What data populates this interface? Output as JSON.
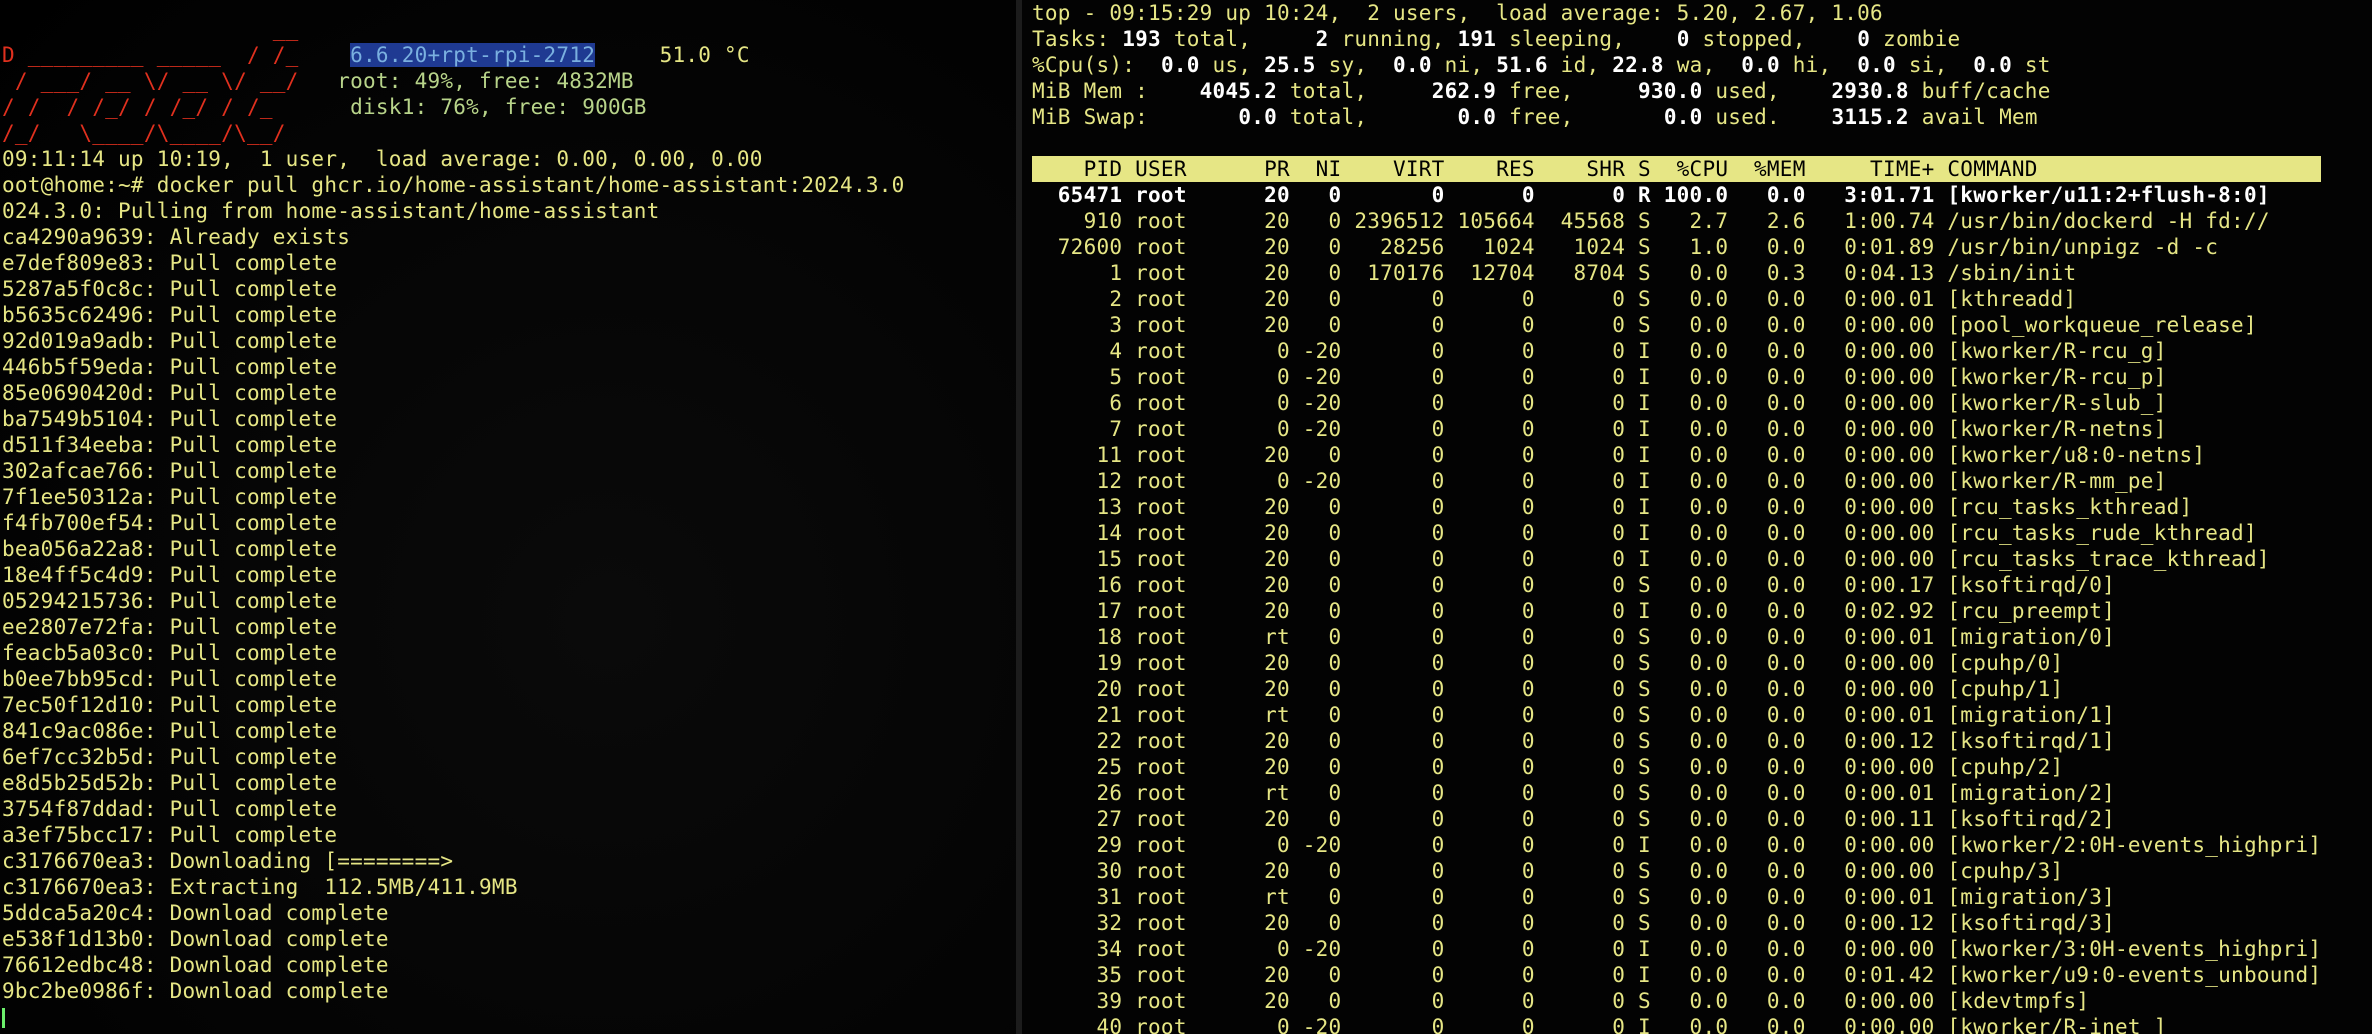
{
  "left_terminal": {
    "banner": {
      "logo_lines": [
        "                     __   ",
        "D _________ _____  / /_   ",
        " / ___/ __ \\/ __ \\/ __/ ",
        "/ /  / /_/ / /_/ / /_    ",
        "/_/   \\____/\\____/\\__/   "
      ],
      "kernel": "6.6.20+rpt-rpi-2712",
      "temperature": "51.0 °C",
      "root_usage": "root: 49%, free: 4832MB",
      "disk_usage": "disk1: 76%, free: 900GB"
    },
    "uptime_line": "09:11:14 up 10:19,  1 user,  load average: 0.00, 0.00, 0.00",
    "command_line": "oot@home:~# docker pull ghcr.io/home-assistant/home-assistant:2024.3.0",
    "output_lines": [
      "024.3.0: Pulling from home-assistant/home-assistant",
      "ca4290a9639: Already exists",
      "e7def809e83: Pull complete",
      "5287a5f0c8c: Pull complete",
      "b5635c62496: Pull complete",
      "92d019a9adb: Pull complete",
      "446b5f59eda: Pull complete",
      "85e0690420d: Pull complete",
      "ba7549b5104: Pull complete",
      "d511f34eeba: Pull complete",
      "302afcae766: Pull complete",
      "7f1ee50312a: Pull complete",
      "f4fb700ef54: Pull complete",
      "bea056a22a8: Pull complete",
      "18e4ff5c4d9: Pull complete",
      "05294215736: Pull complete",
      "ee2807e72fa: Pull complete",
      "feacb5a03c0: Pull complete",
      "b0ee7bb95cd: Pull complete",
      "7ec50f12d10: Pull complete",
      "841c9ac086e: Pull complete",
      "6ef7cc32b5d: Pull complete",
      "e8d5b25d52b: Pull complete",
      "3754f87ddad: Pull complete",
      "a3ef75bcc17: Pull complete",
      "c3176670ea3: Downloading [========>",
      "c3176670ea3: Extracting  112.5MB/411.9MB",
      "5ddca5a20c4: Download complete",
      "e538f1d13b0: Download complete",
      "76612edbc48: Download complete",
      "9bc2be0986f: Download complete"
    ]
  },
  "top": {
    "summary": {
      "line1": "top - 09:15:29 up 10:24,  2 users,  load average: 5.20, 2.67, 1.06",
      "tasks": {
        "label": "Tasks:",
        "total": "193",
        "running": "2",
        "sleeping": "191",
        "stopped": "0",
        "zombie": "0"
      },
      "cpu": {
        "label": "%Cpu(s):",
        "us": "0.0",
        "sy": "25.5",
        "ni": "0.0",
        "id": "51.6",
        "wa": "22.8",
        "hi": "0.0",
        "si": "0.0",
        "st": "0.0"
      },
      "mem": {
        "label": "MiB Mem :",
        "total": "4045.2",
        "free": "262.9",
        "used": "930.0",
        "buff_cache": "2930.8"
      },
      "swap": {
        "label": "MiB Swap:",
        "total": "0.0",
        "free": "0.0",
        "used": "0.0",
        "avail_mem": "3115.2"
      }
    },
    "header": "    PID USER      PR  NI    VIRT    RES    SHR S  %CPU  %MEM     TIME+ COMMAND",
    "rows": [
      "  65471 root      20   0       0      0      0 R 100.0   0.0   3:01.71 [kworker/u11:2+flush-8:0]",
      "    910 root      20   0 2396512 105664  45568 S   2.7   2.6   1:00.74 /usr/bin/dockerd -H fd://",
      "  72600 root      20   0   28256   1024   1024 S   1.0   0.0   0:01.89 /usr/bin/unpigz -d -c",
      "      1 root      20   0  170176  12704   8704 S   0.0   0.3   0:04.13 /sbin/init",
      "      2 root      20   0       0      0      0 S   0.0   0.0   0:00.01 [kthreadd]",
      "      3 root      20   0       0      0      0 S   0.0   0.0   0:00.00 [pool_workqueue_release]",
      "      4 root       0 -20       0      0      0 I   0.0   0.0   0:00.00 [kworker/R-rcu_g]",
      "      5 root       0 -20       0      0      0 I   0.0   0.0   0:00.00 [kworker/R-rcu_p]",
      "      6 root       0 -20       0      0      0 I   0.0   0.0   0:00.00 [kworker/R-slub_]",
      "      7 root       0 -20       0      0      0 I   0.0   0.0   0:00.00 [kworker/R-netns]",
      "     11 root      20   0       0      0      0 I   0.0   0.0   0:00.00 [kworker/u8:0-netns]",
      "     12 root       0 -20       0      0      0 I   0.0   0.0   0:00.00 [kworker/R-mm_pe]",
      "     13 root      20   0       0      0      0 I   0.0   0.0   0:00.00 [rcu_tasks_kthread]",
      "     14 root      20   0       0      0      0 I   0.0   0.0   0:00.00 [rcu_tasks_rude_kthread]",
      "     15 root      20   0       0      0      0 I   0.0   0.0   0:00.00 [rcu_tasks_trace_kthread]",
      "     16 root      20   0       0      0      0 S   0.0   0.0   0:00.17 [ksoftirqd/0]",
      "     17 root      20   0       0      0      0 I   0.0   0.0   0:02.92 [rcu_preempt]",
      "     18 root      rt   0       0      0      0 S   0.0   0.0   0:00.01 [migration/0]",
      "     19 root      20   0       0      0      0 S   0.0   0.0   0:00.00 [cpuhp/0]",
      "     20 root      20   0       0      0      0 S   0.0   0.0   0:00.00 [cpuhp/1]",
      "     21 root      rt   0       0      0      0 S   0.0   0.0   0:00.01 [migration/1]",
      "     22 root      20   0       0      0      0 S   0.0   0.0   0:00.12 [ksoftirqd/1]",
      "     25 root      20   0       0      0      0 S   0.0   0.0   0:00.00 [cpuhp/2]",
      "     26 root      rt   0       0      0      0 S   0.0   0.0   0:00.01 [migration/2]",
      "     27 root      20   0       0      0      0 S   0.0   0.0   0:00.11 [ksoftirqd/2]",
      "     29 root       0 -20       0      0      0 I   0.0   0.0   0:00.00 [kworker/2:0H-events_highpri]",
      "     30 root      20   0       0      0      0 S   0.0   0.0   0:00.00 [cpuhp/3]",
      "     31 root      rt   0       0      0      0 S   0.0   0.0   0:00.01 [migration/3]",
      "     32 root      20   0       0      0      0 S   0.0   0.0   0:00.12 [ksoftirqd/3]",
      "     34 root       0 -20       0      0      0 I   0.0   0.0   0:00.00 [kworker/3:0H-events_highpri]",
      "     35 root      20   0       0      0      0 I   0.0   0.0   0:01.42 [kworker/u9:0-events_unbound]",
      "     39 root      20   0       0      0      0 S   0.0   0.0   0:00.00 [kdevtmpfs]",
      "     40 root       0 -20       0      0      0 I   0.0   0.0   0:00.00 [kworker/R-inet_]"
    ]
  },
  "colors": {
    "terminal_text": "#e6e685",
    "logo": "#e0301e",
    "kernel_highlight": "#1f3a92",
    "header_bar": "#e6e685",
    "cursor": "#6cf06c"
  }
}
